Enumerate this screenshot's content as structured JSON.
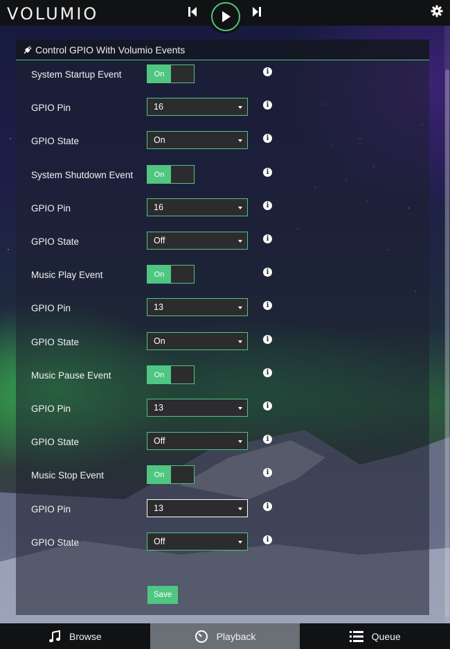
{
  "app": {
    "logo_text": "VOLUMIO"
  },
  "player": {
    "prev_icon": "skip-previous-icon",
    "play_icon": "play-icon",
    "next_icon": "skip-next-icon",
    "settings_icon": "gear-icon"
  },
  "panel": {
    "title": "Control GPIO With Volumio Events",
    "title_icon": "plug-icon"
  },
  "rows": [
    {
      "label": "System Startup Event",
      "type": "toggle",
      "value": "On"
    },
    {
      "label": "GPIO Pin",
      "type": "select",
      "value": "16"
    },
    {
      "label": "GPIO State",
      "type": "select",
      "value": "On"
    },
    {
      "label": "System Shutdown Event",
      "type": "toggle",
      "value": "On"
    },
    {
      "label": "GPIO Pin",
      "type": "select",
      "value": "16"
    },
    {
      "label": "GPIO State",
      "type": "select",
      "value": "Off"
    },
    {
      "label": "Music Play Event",
      "type": "toggle",
      "value": "On"
    },
    {
      "label": "GPIO Pin",
      "type": "select",
      "value": "13"
    },
    {
      "label": "GPIO State",
      "type": "select",
      "value": "On"
    },
    {
      "label": "Music Pause Event",
      "type": "toggle",
      "value": "On"
    },
    {
      "label": "GPIO Pin",
      "type": "select",
      "value": "13"
    },
    {
      "label": "GPIO State",
      "type": "select",
      "value": "Off"
    },
    {
      "label": "Music Stop Event",
      "type": "toggle",
      "value": "On"
    },
    {
      "label": "GPIO Pin",
      "type": "select",
      "value": "13"
    },
    {
      "label": "GPIO State",
      "type": "select",
      "value": "Off"
    }
  ],
  "info_glyph": "i",
  "save_label": "Save",
  "nav": [
    {
      "label": "Browse",
      "icon": "music-note-icon",
      "active": false
    },
    {
      "label": "Playback",
      "icon": "clock-icon",
      "active": true
    },
    {
      "label": "Queue",
      "icon": "list-icon",
      "active": false
    }
  ],
  "colors": {
    "accent": "#4fc682",
    "bar": "#111214",
    "field": "#2c2c2e",
    "active_tab": "#6b7077"
  }
}
